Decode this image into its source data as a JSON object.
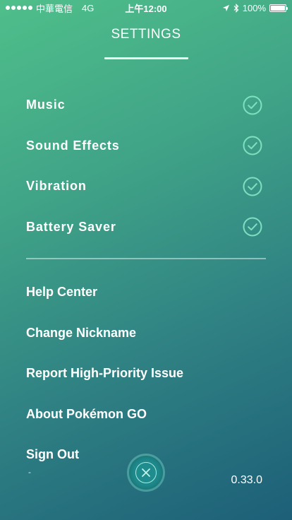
{
  "status_bar": {
    "carrier": "中華電信",
    "network": "4G",
    "time": "上午12:00",
    "battery": "100%",
    "battery_level": 1.0
  },
  "header": {
    "title": "SETTINGS"
  },
  "toggles": [
    {
      "label": "Music",
      "checked": true
    },
    {
      "label": "Sound Effects",
      "checked": true
    },
    {
      "label": "Vibration",
      "checked": true
    },
    {
      "label": "Battery Saver",
      "checked": true
    }
  ],
  "menu": [
    {
      "label": "Help Center"
    },
    {
      "label": "Change Nickname"
    },
    {
      "label": "Report High-Priority Issue"
    },
    {
      "label": "About Pokémon GO"
    },
    {
      "label": "Sign Out"
    }
  ],
  "footer": {
    "dash": "-",
    "version": "0.33.0"
  },
  "colors": {
    "accent_check": "#7fe0c0",
    "close_button": "#1f8c8e"
  },
  "icons": {
    "toggle_check": "check-circle-icon",
    "close": "close-icon"
  }
}
